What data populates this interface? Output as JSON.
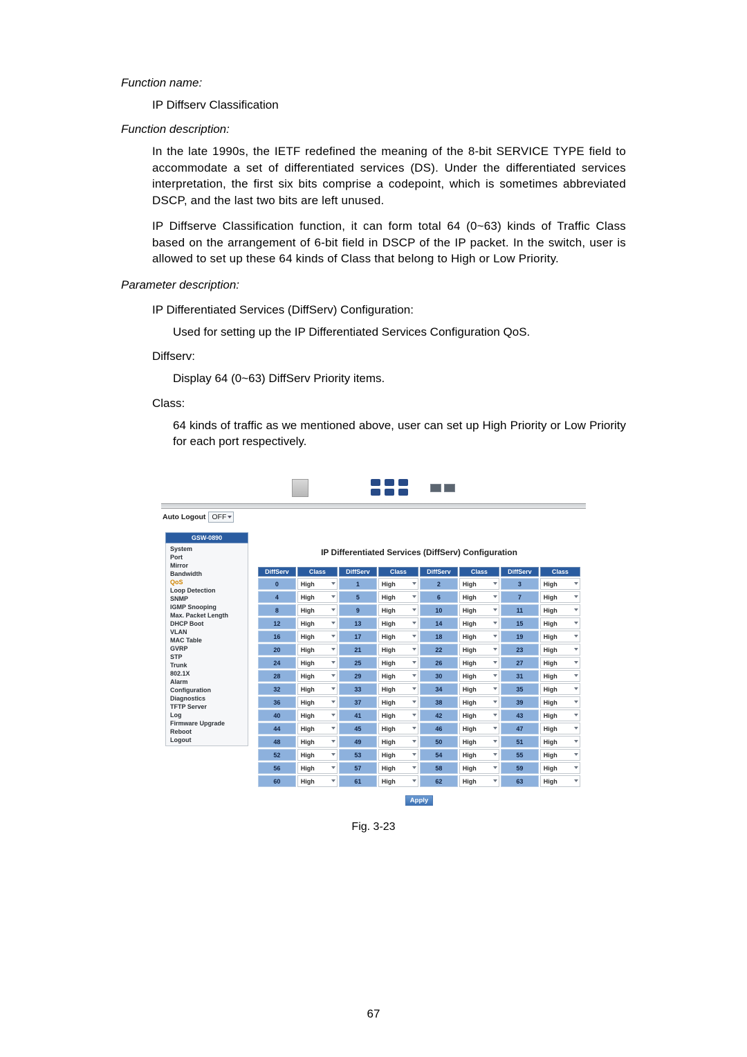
{
  "doc": {
    "fn_name_label": "Function name:",
    "fn_name_value": "IP Diffserv Classification",
    "fn_desc_label": "Function description:",
    "fn_desc_p1": "In the late 1990s, the IETF redefined the meaning of the 8-bit SERVICE TYPE field to accommodate a set of differentiated services (DS). Under the differentiated services interpretation, the first six bits comprise a codepoint, which is sometimes abbreviated DSCP, and the last two bits are left unused.",
    "fn_desc_p2": "IP Diffserve Classification function, it can form total 64 (0~63) kinds of Traffic Class based on the arrangement of 6-bit field in DSCP of the IP packet.  In the switch, user is allowed to set up these 64 kinds of Class that belong to High or Low Priority.",
    "param_desc_label": "Parameter description:",
    "param1_title": "IP Differentiated Services (DiffServ) Configuration:",
    "param1_body": "Used for setting up the IP Differentiated Services Configuration QoS.",
    "param2_title": "Diffserv:",
    "param2_body": "Display 64 (0~63) DiffServ Priority items.",
    "param3_title": "Class:",
    "param3_body": "64 kinds of traffic as we mentioned above, user can set up High Priority or Low Priority for each port respectively.",
    "figure_caption": "Fig. 3-23",
    "page_number": "67"
  },
  "ui": {
    "auto_logout_label": "Auto Logout",
    "auto_logout_value": "OFF",
    "sidebar_header": "GSW-0890",
    "sidebar_items": [
      {
        "label": "System",
        "hl": false
      },
      {
        "label": "Port",
        "hl": false
      },
      {
        "label": "Mirror",
        "hl": false
      },
      {
        "label": "Bandwidth",
        "hl": false
      },
      {
        "label": "QoS",
        "hl": true
      },
      {
        "label": "Loop Detection",
        "hl": false
      },
      {
        "label": "SNMP",
        "hl": false
      },
      {
        "label": "IGMP Snooping",
        "hl": false
      },
      {
        "label": "Max. Packet Length",
        "hl": false
      },
      {
        "label": "DHCP Boot",
        "hl": false
      },
      {
        "label": "VLAN",
        "hl": false
      },
      {
        "label": "MAC Table",
        "hl": false
      },
      {
        "label": "GVRP",
        "hl": false
      },
      {
        "label": "STP",
        "hl": false
      },
      {
        "label": "Trunk",
        "hl": false
      },
      {
        "label": "802.1X",
        "hl": false
      },
      {
        "label": "Alarm",
        "hl": false
      },
      {
        "label": "Configuration",
        "hl": false
      },
      {
        "label": "Diagnostics",
        "hl": false
      },
      {
        "label": "TFTP Server",
        "hl": false
      },
      {
        "label": "Log",
        "hl": false
      },
      {
        "label": "Firmware Upgrade",
        "hl": false
      },
      {
        "label": "Reboot",
        "hl": false
      },
      {
        "label": "Logout",
        "hl": false
      }
    ],
    "panel_title": "IP Differentiated Services (DiffServ) Configuration",
    "col_headers": [
      "DiffServ",
      "Class",
      "DiffServ",
      "Class",
      "DiffServ",
      "Class",
      "DiffServ",
      "Class"
    ],
    "class_value": "High",
    "apply_label": "Apply"
  }
}
